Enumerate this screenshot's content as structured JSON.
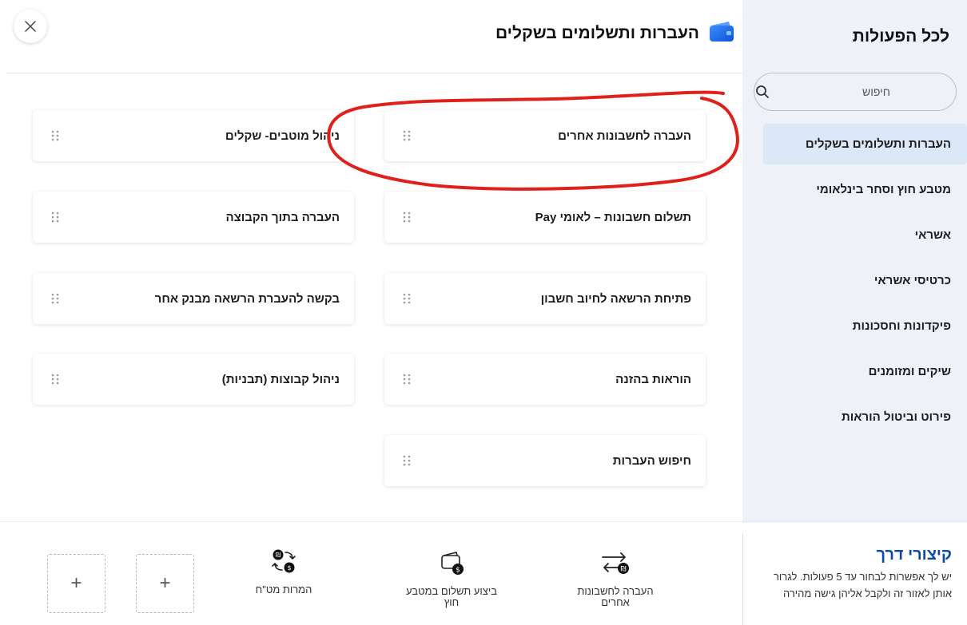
{
  "header": {
    "title": "העברות ותשלומים בשקלים"
  },
  "sidebar": {
    "title": "לכל הפעולות",
    "search_placeholder": "חיפוש",
    "items": [
      {
        "label": "העברות ותשלומים בשקלים",
        "active": true
      },
      {
        "label": "מטבע חוץ וסחר בינלאומי"
      },
      {
        "label": "אשראי"
      },
      {
        "label": "כרטיסי אשראי"
      },
      {
        "label": "פיקדונות וחסכונות"
      },
      {
        "label": "שיקים ומזומנים"
      },
      {
        "label": "פירוט וביטול הוראות"
      }
    ]
  },
  "actions": {
    "transfer_other_accounts": "העברה לחשבונות אחרים",
    "manage_beneficiaries": "ניהול מוטבים- שקלים",
    "pay_accounts_leumi_pay": "תשלום חשבונות – לאומי Pay",
    "transfer_within_group": "העברה בתוך הקבוצה",
    "open_debit_authorization": "פתיחת הרשאה לחיוב חשבון",
    "request_transfer_authorization": "בקשה להעברת הרשאה מבנק אחר",
    "standing_orders": "הוראות בהזנה",
    "manage_groups_templates": "ניהול קבוצות (תבניות)",
    "search_transfers": "חיפוש העברות"
  },
  "shortcuts": {
    "title": "קיצורי דרך",
    "description": "יש לך אפשרות לבחור עד 5 פעולות. לגרור אותן לאזור זה ולקבל אליהן גישה מהירה",
    "items": [
      {
        "label_line1": "העברה לחשבונות",
        "label_line2": "אחרים",
        "icon": "transfer-arrows-icon"
      },
      {
        "label_line1": "ביצוע תשלום במטבע",
        "label_line2": "חוץ",
        "icon": "wallet-dollar-icon"
      },
      {
        "label_line1": "המרות מט\"ח",
        "label_line2": "",
        "icon": "currency-exchange-icon"
      }
    ],
    "add_symbol": "+"
  },
  "colors": {
    "sidebar_bg": "#eef2f8",
    "active_item_bg": "#dce8f8",
    "accent_blue": "#0a4ba8",
    "annotation_red": "#e0201b"
  }
}
